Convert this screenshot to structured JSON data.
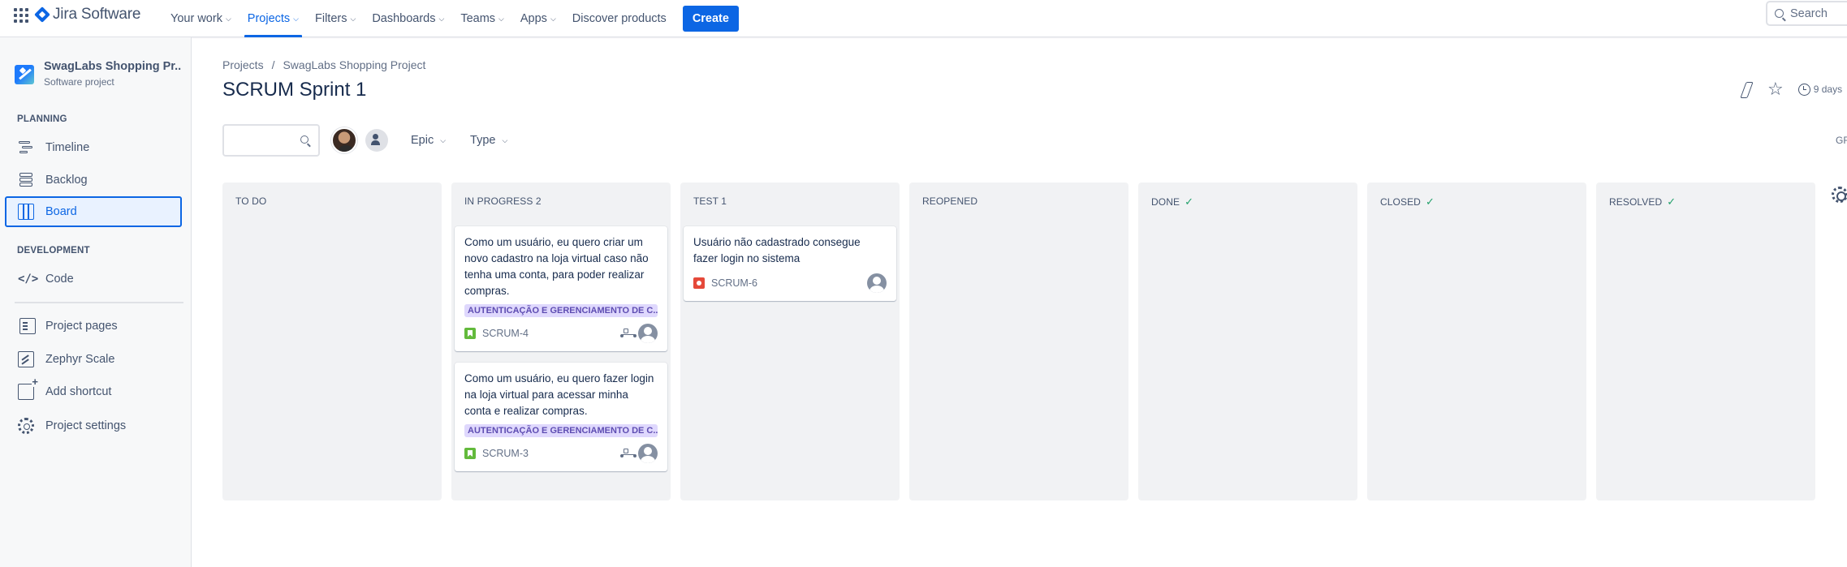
{
  "topnav": {
    "logo_text": "Jira Software",
    "items": [
      {
        "label": "Your work",
        "has_menu": true,
        "active": false
      },
      {
        "label": "Projects",
        "has_menu": true,
        "active": true
      },
      {
        "label": "Filters",
        "has_menu": true,
        "active": false
      },
      {
        "label": "Dashboards",
        "has_menu": true,
        "active": false
      },
      {
        "label": "Teams",
        "has_menu": true,
        "active": false
      },
      {
        "label": "Apps",
        "has_menu": true,
        "active": false
      },
      {
        "label": "Discover products",
        "has_menu": false,
        "active": false
      }
    ],
    "create_label": "Create",
    "search_placeholder": "Search"
  },
  "sidebar": {
    "project_name": "SwagLabs Shopping Pr...",
    "project_type": "Software project",
    "planning_label": "PLANNING",
    "planning_items": [
      {
        "label": "Timeline",
        "icon": "timeline-icon"
      },
      {
        "label": "Backlog",
        "icon": "backlog-icon"
      },
      {
        "label": "Board",
        "icon": "board-icon",
        "active": true
      }
    ],
    "development_label": "DEVELOPMENT",
    "development_items": [
      {
        "label": "Code",
        "icon": "code-icon"
      }
    ],
    "other_items": [
      {
        "label": "Project pages",
        "icon": "pages-icon"
      },
      {
        "label": "Zephyr Scale",
        "icon": "zephyr-icon"
      },
      {
        "label": "Add shortcut",
        "icon": "add-shortcut-icon"
      },
      {
        "label": "Project settings",
        "icon": "settings-icon"
      }
    ]
  },
  "main": {
    "breadcrumbs": [
      "Projects",
      "SwagLabs Shopping Project"
    ],
    "breadcrumb_separator": "/",
    "title": "SCRUM Sprint 1",
    "days_remaining": "9 days",
    "filters": {
      "epic_label": "Epic",
      "type_label": "Type"
    },
    "group_label": "GR"
  },
  "board": {
    "columns": [
      {
        "name": "TO DO",
        "done": false,
        "cards": []
      },
      {
        "name": "IN PROGRESS 2",
        "done": false,
        "cards": [
          {
            "summary": "Como um usuário, eu quero criar um novo cadastro na loja virtual caso não tenha uma conta, para poder realizar compras.",
            "epic": "AUTENTICAÇÃO E GERENCIAMENTO DE C...",
            "key": "SCRUM-4",
            "type": "story"
          },
          {
            "summary": "Como um usuário, eu quero fazer login na loja virtual para acessar minha conta e realizar compras.",
            "epic": "AUTENTICAÇÃO E GERENCIAMENTO DE C...",
            "key": "SCRUM-3",
            "type": "story"
          }
        ]
      },
      {
        "name": "TEST 1",
        "done": false,
        "cards": [
          {
            "summary": "Usuário não cadastrado consegue fazer login no sistema",
            "epic": "",
            "key": "SCRUM-6",
            "type": "bug"
          }
        ]
      },
      {
        "name": "REOPENED",
        "done": false,
        "cards": []
      },
      {
        "name": "DONE",
        "done": true,
        "cards": []
      },
      {
        "name": "CLOSED",
        "done": true,
        "cards": []
      },
      {
        "name": "RESOLVED",
        "done": true,
        "cards": []
      }
    ]
  },
  "colors": {
    "accent": "#0c66e4",
    "epic_bg": "#dfd8fd",
    "epic_text": "#5e4db2",
    "story": "#63ba3c",
    "bug": "#e5493a",
    "done_check": "#22a06b"
  }
}
